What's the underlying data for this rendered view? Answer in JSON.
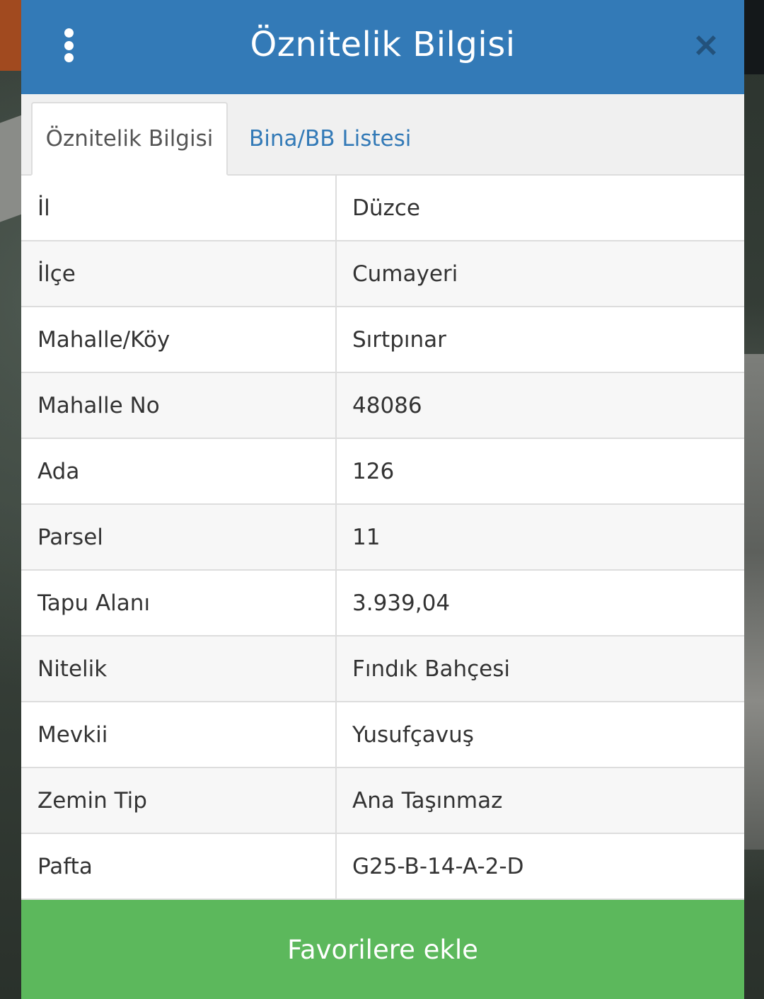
{
  "header": {
    "title": "Öznitelik Bilgisi"
  },
  "tabs": [
    {
      "label": "Öznitelik Bilgisi",
      "active": true
    },
    {
      "label": "Bina/BB Listesi",
      "active": false
    }
  ],
  "rows": [
    {
      "key": "İl",
      "value": "Düzce"
    },
    {
      "key": "İlçe",
      "value": "Cumayeri"
    },
    {
      "key": "Mahalle/Köy",
      "value": "Sırtpınar"
    },
    {
      "key": "Mahalle No",
      "value": "48086"
    },
    {
      "key": "Ada",
      "value": "126"
    },
    {
      "key": "Parsel",
      "value": "11"
    },
    {
      "key": "Tapu Alanı",
      "value": "3.939,04"
    },
    {
      "key": "Nitelik",
      "value": "Fındık Bahçesi"
    },
    {
      "key": "Mevkii",
      "value": "Yusufçavuş"
    },
    {
      "key": "Zemin Tip",
      "value": "Ana Taşınmaz"
    },
    {
      "key": "Pafta",
      "value": "G25-B-14-A-2-D"
    }
  ],
  "footer": {
    "button_label": "Favorilere ekle"
  },
  "icons": {
    "menu": "vertical-dots-icon",
    "close": "close-icon"
  },
  "colors": {
    "header": "#337ab7",
    "tab_link": "#337ab7",
    "favorite_button": "#5cb85c",
    "close_icon": "#23527c"
  }
}
